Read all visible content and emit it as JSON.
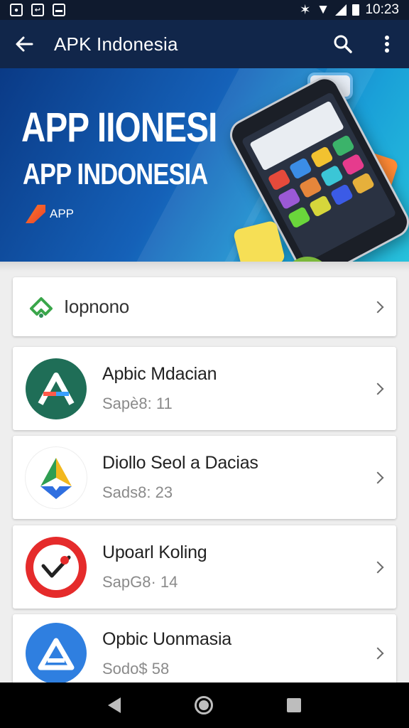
{
  "status_bar": {
    "time": "10:23"
  },
  "app_bar": {
    "title": "APK Indonesia"
  },
  "banner": {
    "headline": "APP IIONESI",
    "subheadline": "APP INDONESIA",
    "logo_text": "APP"
  },
  "category": {
    "label": "Iopnono"
  },
  "apps": [
    {
      "name": "Apbic Mdacian",
      "subtitle": "Sapè8: 11",
      "icon": "a-logo-green-icon",
      "color": "#1f6e57"
    },
    {
      "name": "Diollo Seol a Dacias",
      "subtitle": "Sads8: 23",
      "icon": "triangle-logo-icon",
      "color": "#ffffff"
    },
    {
      "name": "Upoarl Koling",
      "subtitle": "SapG8· 14",
      "icon": "checkmark-logo-red-icon",
      "color": "#e52b2b"
    },
    {
      "name": "Opbic Uonmasia",
      "subtitle": "Sodo$ 58",
      "icon": "a-logo-blue-icon",
      "color": "#2f7fe0"
    }
  ]
}
